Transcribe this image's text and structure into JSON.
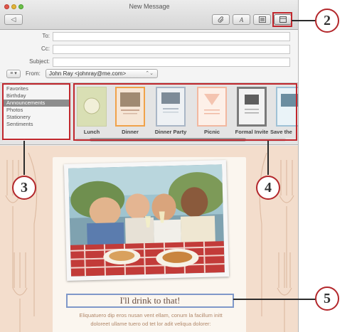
{
  "window": {
    "title": "New Message"
  },
  "toolbar": {
    "send_glyph": "◁",
    "attach_glyph": "🖇",
    "format_glyph": "A",
    "photo_glyph": "▣",
    "template_glyph": "☐"
  },
  "headers": {
    "to_label": "To:",
    "cc_label": "Cc:",
    "subject_label": "Subject:",
    "to_value": "",
    "cc_value": "",
    "subject_value": "",
    "from_label": "From:",
    "from_value": "John Ray <johnray@me.com>",
    "list_glyph": "≡ ▾",
    "select_arrows": "⌃⌄"
  },
  "stationery": {
    "categories": [
      "Favorites",
      "Birthday",
      "Announcements",
      "Photos",
      "Stationery",
      "Sentiments"
    ],
    "selected_category": "Announcements",
    "templates": [
      "Lunch",
      "Dinner",
      "Dinner Party",
      "Picnic",
      "Formal Invite",
      "Save the"
    ]
  },
  "message": {
    "caption": "I'll drink to that!",
    "body_line1": "Eliquatuero dip eros nusan vent ellam, conum la facillum initt",
    "body_line2": "doloreet ullame tuero od tet lor adit veliqua dolorer:"
  },
  "callouts": {
    "c2": "2",
    "c3": "3",
    "c4": "4",
    "c5": "5"
  },
  "colors": {
    "highlight": "#c1272d",
    "caption_border": "#7f98c9",
    "background_pattern": "#f3ddcc"
  }
}
